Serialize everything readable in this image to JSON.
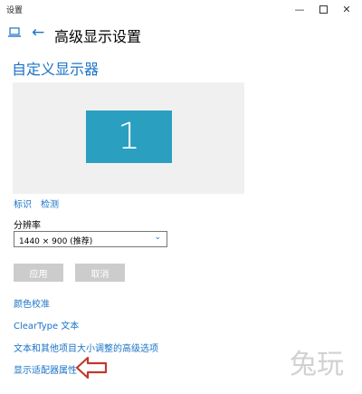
{
  "window": {
    "title": "设置",
    "min_glyph": "—",
    "close_glyph": "✕"
  },
  "header": {
    "back_glyph": "←",
    "title": "高级显示设置"
  },
  "section": {
    "title": "自定义显示器"
  },
  "preview": {
    "monitor_number": "1",
    "monitor_color": "#2a9fc0"
  },
  "links": {
    "identify": "标识",
    "detect": "检测"
  },
  "resolution": {
    "label": "分辨率",
    "value": "1440 × 900 (推荐)",
    "chevron": "⌄"
  },
  "buttons": {
    "apply": "应用",
    "cancel": "取消"
  },
  "options": {
    "color_calibration": "颜色校准",
    "cleartype": "ClearType 文本",
    "text_sizing": "文本和其他项目大小调整的高级选项",
    "adapter_properties": "显示适配器属性"
  },
  "watermark": {
    "text": "兔玩"
  },
  "colors": {
    "accent": "#1a73c7",
    "arrow": "#c0392b",
    "disabled_button": "#cccccc"
  }
}
